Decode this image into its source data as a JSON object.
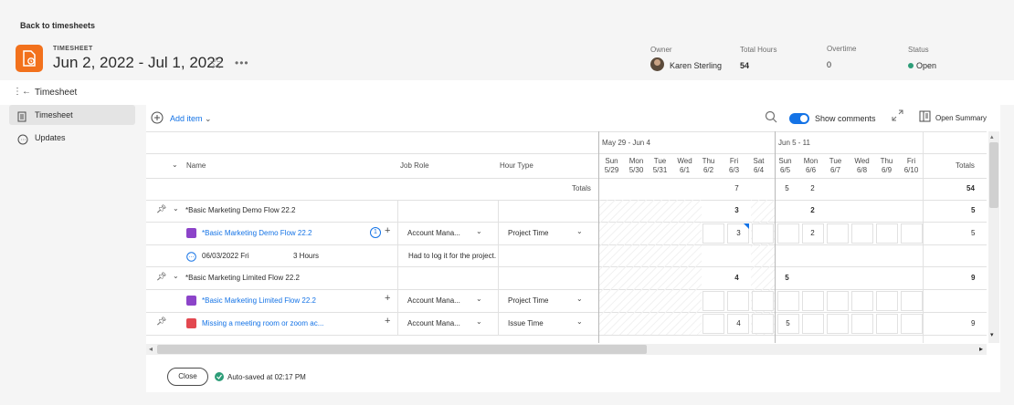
{
  "header": {
    "back_link": "Back to timesheets",
    "type_label": "TIMESHEET",
    "title": "Jun 2, 2022 - Jul 1, 2022",
    "owner_label": "Owner",
    "owner_name": "Karen Sterling",
    "total_hours_label": "Total Hours",
    "total_hours": "54",
    "overtime_label": "Overtime",
    "overtime": "0",
    "status_label": "Status",
    "status": "Open",
    "accent": "#f2711c",
    "status_color": "#2d9d78"
  },
  "subheader": {
    "title": "Timesheet"
  },
  "sidebar": {
    "items": [
      {
        "label": "Timesheet",
        "icon": "document-icon"
      },
      {
        "label": "Updates",
        "icon": "comment-icon"
      }
    ]
  },
  "toolbar": {
    "add_item": "Add item",
    "show_comments": "Show comments",
    "open_summary": "Open Summary"
  },
  "grid": {
    "weeks": [
      "May 29 - Jun 4",
      "Jun 5 - 11"
    ],
    "days": [
      {
        "d": "Sun",
        "n": "5/29"
      },
      {
        "d": "Mon",
        "n": "5/30"
      },
      {
        "d": "Tue",
        "n": "5/31"
      },
      {
        "d": "Wed",
        "n": "6/1"
      },
      {
        "d": "Thu",
        "n": "6/2"
      },
      {
        "d": "Fri",
        "n": "6/3"
      },
      {
        "d": "Sat",
        "n": "6/4"
      },
      {
        "d": "Sun",
        "n": "6/5"
      },
      {
        "d": "Mon",
        "n": "6/6"
      },
      {
        "d": "Tue",
        "n": "6/7"
      },
      {
        "d": "Wed",
        "n": "6/8"
      },
      {
        "d": "Thu",
        "n": "6/9"
      },
      {
        "d": "Fri",
        "n": "6/10"
      }
    ],
    "columns": {
      "name": "Name",
      "job_role": "Job Role",
      "hour_type": "Hour Type",
      "totals": "Totals"
    },
    "totals_label": "Totals",
    "totals_row": {
      "fri_6_3": "7",
      "sun_6_5": "5",
      "mon_6_6": "2",
      "total": "54"
    },
    "rows": [
      {
        "name": "*Basic Marketing Demo Flow 22.2",
        "fri": "3",
        "mon": "2",
        "total": "5"
      },
      {
        "name": "*Basic Marketing Demo Flow 22.2",
        "job_role": "Account Mana...",
        "hour_type": "Project Time",
        "fri": "3",
        "mon": "2",
        "total": "5",
        "comment_count": "1"
      },
      {
        "comment_date": "06/03/2022 Fri",
        "comment_hours": "3 Hours",
        "comment_text": "Had to log it for the project."
      },
      {
        "name": "*Basic Marketing Limited Flow 22.2",
        "fri": "4",
        "sun": "5",
        "total": "9"
      },
      {
        "name": "*Basic Marketing Limited Flow 22.2",
        "job_role": "Account Mana...",
        "hour_type": "Project Time"
      },
      {
        "name": "Missing a meeting room or zoom ac...",
        "job_role": "Account Mana...",
        "hour_type": "Issue Time",
        "fri": "4",
        "sun": "5",
        "total": "9"
      }
    ]
  },
  "footer": {
    "close": "Close",
    "autosave": "Auto-saved at 02:17 PM"
  }
}
